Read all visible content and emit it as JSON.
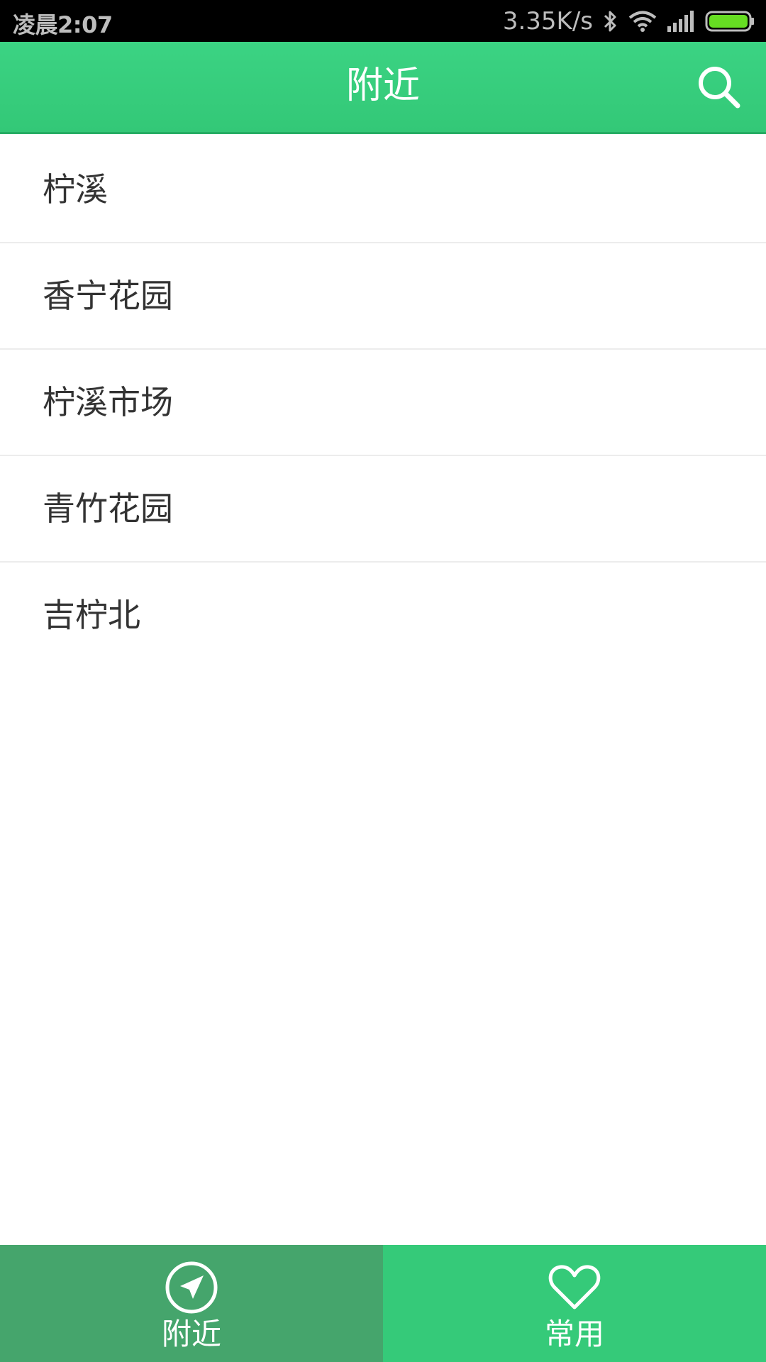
{
  "status_bar": {
    "time": "凌晨2:07",
    "network_speed": "3.35K/s",
    "icons": [
      "bluetooth-icon",
      "wifi-icon",
      "signal-icon",
      "battery-icon"
    ],
    "battery_color": "#66dd22"
  },
  "header": {
    "title": "附近",
    "search_icon": "search-icon",
    "background_color": "#37cc7b"
  },
  "places": [
    {
      "label": "柠溪"
    },
    {
      "label": "香宁花园"
    },
    {
      "label": "柠溪市场"
    },
    {
      "label": "青竹花园"
    },
    {
      "label": "吉柠北"
    }
  ],
  "bottom_nav": {
    "tabs": [
      {
        "label": "附近",
        "icon": "navigation-arrow-icon",
        "active": true,
        "color": "#45a56c"
      },
      {
        "label": "常用",
        "icon": "heart-icon",
        "active": false,
        "color": "#35ca79"
      }
    ]
  }
}
